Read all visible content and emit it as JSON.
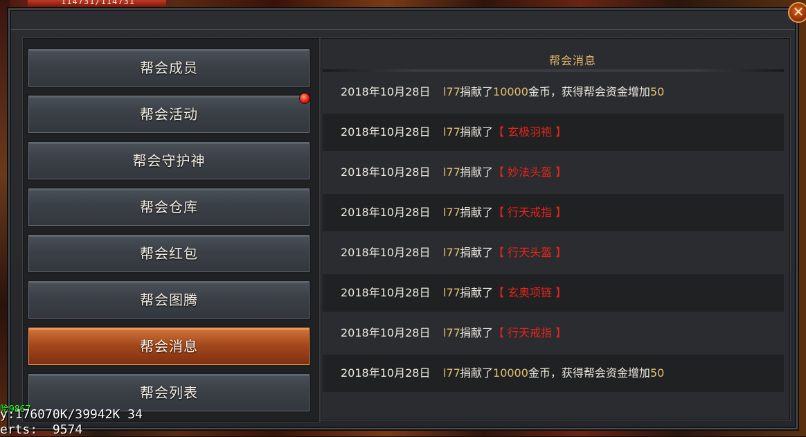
{
  "hud": {
    "hp_text": "114731/114731"
  },
  "window": {
    "close_glyph": "✕"
  },
  "nav": [
    {
      "label": "帮会成员",
      "active": false
    },
    {
      "label": "帮会活动",
      "active": false,
      "badge": true
    },
    {
      "label": "帮会守护神",
      "active": false
    },
    {
      "label": "帮会仓库",
      "active": false
    },
    {
      "label": "帮会红包",
      "active": false
    },
    {
      "label": "帮会图腾",
      "active": false
    },
    {
      "label": "帮会消息",
      "active": true
    },
    {
      "label": "帮会列表",
      "active": false
    }
  ],
  "panel": {
    "title": "帮会消息"
  },
  "messages": [
    {
      "date": "2018年10月28日",
      "who": "l77",
      "verb": "捐献了",
      "amount": "10000",
      "mid": "金币，获得帮会资金增加",
      "fund": "50"
    },
    {
      "date": "2018年10月28日",
      "who": "l77",
      "verb": "捐献了",
      "item": "【 玄极羽袍 】"
    },
    {
      "date": "2018年10月28日",
      "who": "l77",
      "verb": "捐献了",
      "item": "【 妙法头盔 】"
    },
    {
      "date": "2018年10月28日",
      "who": "l77",
      "verb": "捐献了",
      "item": "【 行天戒指 】"
    },
    {
      "date": "2018年10月28日",
      "who": "l77",
      "verb": "捐献了",
      "item": "【 行天头盔 】"
    },
    {
      "date": "2018年10月28日",
      "who": "l77",
      "verb": "捐献了",
      "item": "【 玄奥项链 】"
    },
    {
      "date": "2018年10月28日",
      "who": "l77",
      "verb": "捐献了",
      "item": "【 行天戒指 】"
    },
    {
      "date": "2018年10月28日",
      "who": "l77",
      "verb": "捐献了",
      "amount": "10000",
      "mid": "金币，获得帮会资金增加",
      "fund": "50"
    }
  ],
  "debug": {
    "line1": "险9867",
    "line2": "y:176070K/39942K 34",
    "line3": "erts:  9574"
  },
  "colors": {
    "accent_gold": "#e4c070",
    "item_red": "#e8251a",
    "active_tab": "#a5481c"
  }
}
